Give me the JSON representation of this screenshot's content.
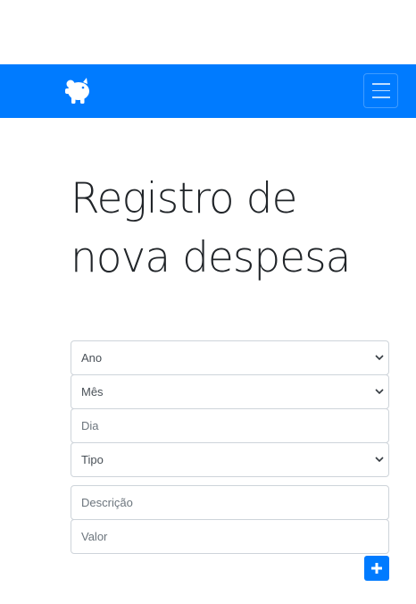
{
  "page": {
    "title": "Registro de nova despesa"
  },
  "navbar": {
    "brand_icon": "piggy-bank-icon",
    "toggle_icon": "hamburger-menu-icon",
    "color": "#007bff"
  },
  "form": {
    "ano_select": {
      "value": "Ano"
    },
    "mes_select": {
      "value": "Mês"
    },
    "dia_input": {
      "placeholder": "Dia"
    },
    "tipo_select": {
      "value": "Tipo"
    },
    "descricao_input": {
      "placeholder": "Descrição"
    },
    "valor_input": {
      "placeholder": "Valor"
    },
    "add_button_icon": "plus-icon"
  }
}
